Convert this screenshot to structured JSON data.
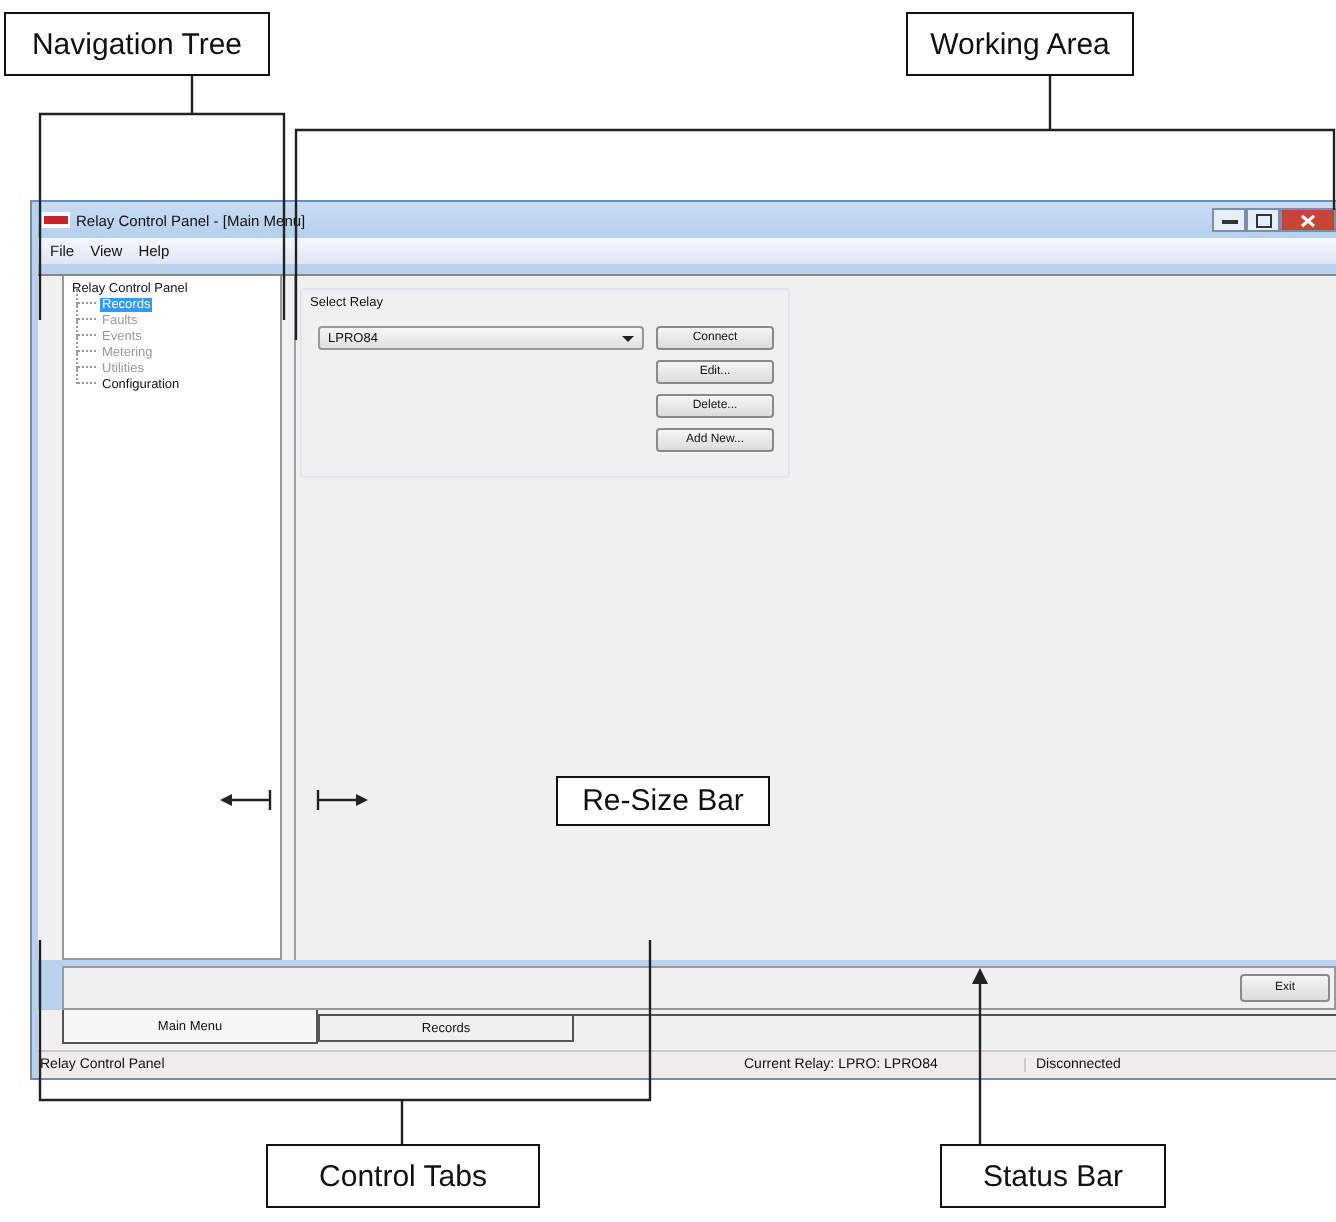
{
  "callouts": [
    {
      "kind": "bracket-top",
      "label": "Navigation Tree"
    },
    {
      "kind": "bracket-top",
      "label": "Working Area"
    },
    {
      "kind": "resize",
      "label": "Re-Size Bar"
    },
    {
      "kind": "bracket-bottom",
      "label": "Control Tabs"
    },
    {
      "kind": "arrow-up",
      "label": "Status Bar"
    }
  ],
  "window": {
    "title": "Relay Control Panel - [Main Menu]"
  },
  "menu": [
    "File",
    "View",
    "Help"
  ],
  "tree": {
    "label": "Relay Control Panel",
    "children": [
      {
        "label": "Records",
        "selected": true,
        "disabled": false
      },
      {
        "label": "Faults",
        "selected": false,
        "disabled": true
      },
      {
        "label": "Events",
        "selected": false,
        "disabled": true
      },
      {
        "label": "Metering",
        "selected": false,
        "disabled": true
      },
      {
        "label": "Utilities",
        "selected": false,
        "disabled": true
      },
      {
        "label": "Configuration",
        "selected": false,
        "disabled": false
      }
    ]
  },
  "select_relay": {
    "title": "Select Relay",
    "value": "LPRO84",
    "buttons": [
      "Connect",
      "Edit...",
      "Delete...",
      "Add New..."
    ]
  },
  "exit_button": "Exit",
  "tabs": [
    {
      "label": "Main Menu",
      "selected": true
    },
    {
      "label": "Records",
      "selected": false
    }
  ],
  "status_bar": [
    "Relay Control Panel",
    "Current Relay: LPRO: LPRO84",
    "Disconnected"
  ]
}
